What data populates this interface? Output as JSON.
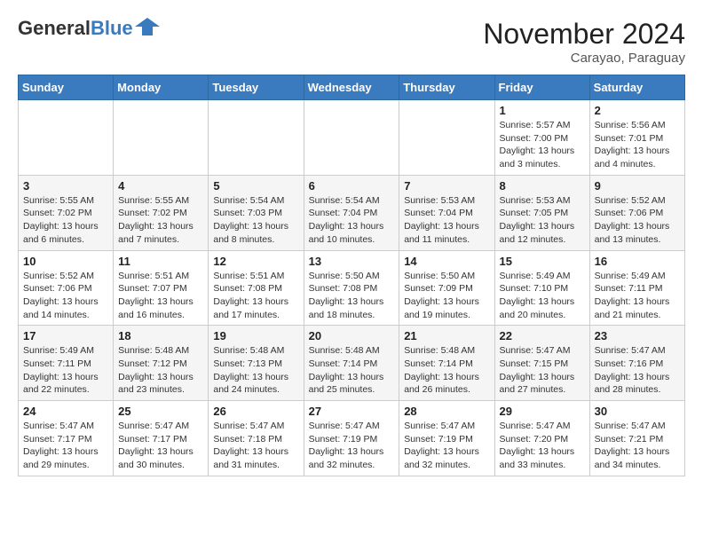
{
  "header": {
    "logo_general": "General",
    "logo_blue": "Blue",
    "month_title": "November 2024",
    "subtitle": "Carayao, Paraguay"
  },
  "weekdays": [
    "Sunday",
    "Monday",
    "Tuesday",
    "Wednesday",
    "Thursday",
    "Friday",
    "Saturday"
  ],
  "weeks": [
    [
      {
        "day": "",
        "detail": ""
      },
      {
        "day": "",
        "detail": ""
      },
      {
        "day": "",
        "detail": ""
      },
      {
        "day": "",
        "detail": ""
      },
      {
        "day": "",
        "detail": ""
      },
      {
        "day": "1",
        "detail": "Sunrise: 5:57 AM\nSunset: 7:00 PM\nDaylight: 13 hours and 3 minutes."
      },
      {
        "day": "2",
        "detail": "Sunrise: 5:56 AM\nSunset: 7:01 PM\nDaylight: 13 hours and 4 minutes."
      }
    ],
    [
      {
        "day": "3",
        "detail": "Sunrise: 5:55 AM\nSunset: 7:02 PM\nDaylight: 13 hours and 6 minutes."
      },
      {
        "day": "4",
        "detail": "Sunrise: 5:55 AM\nSunset: 7:02 PM\nDaylight: 13 hours and 7 minutes."
      },
      {
        "day": "5",
        "detail": "Sunrise: 5:54 AM\nSunset: 7:03 PM\nDaylight: 13 hours and 8 minutes."
      },
      {
        "day": "6",
        "detail": "Sunrise: 5:54 AM\nSunset: 7:04 PM\nDaylight: 13 hours and 10 minutes."
      },
      {
        "day": "7",
        "detail": "Sunrise: 5:53 AM\nSunset: 7:04 PM\nDaylight: 13 hours and 11 minutes."
      },
      {
        "day": "8",
        "detail": "Sunrise: 5:53 AM\nSunset: 7:05 PM\nDaylight: 13 hours and 12 minutes."
      },
      {
        "day": "9",
        "detail": "Sunrise: 5:52 AM\nSunset: 7:06 PM\nDaylight: 13 hours and 13 minutes."
      }
    ],
    [
      {
        "day": "10",
        "detail": "Sunrise: 5:52 AM\nSunset: 7:06 PM\nDaylight: 13 hours and 14 minutes."
      },
      {
        "day": "11",
        "detail": "Sunrise: 5:51 AM\nSunset: 7:07 PM\nDaylight: 13 hours and 16 minutes."
      },
      {
        "day": "12",
        "detail": "Sunrise: 5:51 AM\nSunset: 7:08 PM\nDaylight: 13 hours and 17 minutes."
      },
      {
        "day": "13",
        "detail": "Sunrise: 5:50 AM\nSunset: 7:08 PM\nDaylight: 13 hours and 18 minutes."
      },
      {
        "day": "14",
        "detail": "Sunrise: 5:50 AM\nSunset: 7:09 PM\nDaylight: 13 hours and 19 minutes."
      },
      {
        "day": "15",
        "detail": "Sunrise: 5:49 AM\nSunset: 7:10 PM\nDaylight: 13 hours and 20 minutes."
      },
      {
        "day": "16",
        "detail": "Sunrise: 5:49 AM\nSunset: 7:11 PM\nDaylight: 13 hours and 21 minutes."
      }
    ],
    [
      {
        "day": "17",
        "detail": "Sunrise: 5:49 AM\nSunset: 7:11 PM\nDaylight: 13 hours and 22 minutes."
      },
      {
        "day": "18",
        "detail": "Sunrise: 5:48 AM\nSunset: 7:12 PM\nDaylight: 13 hours and 23 minutes."
      },
      {
        "day": "19",
        "detail": "Sunrise: 5:48 AM\nSunset: 7:13 PM\nDaylight: 13 hours and 24 minutes."
      },
      {
        "day": "20",
        "detail": "Sunrise: 5:48 AM\nSunset: 7:14 PM\nDaylight: 13 hours and 25 minutes."
      },
      {
        "day": "21",
        "detail": "Sunrise: 5:48 AM\nSunset: 7:14 PM\nDaylight: 13 hours and 26 minutes."
      },
      {
        "day": "22",
        "detail": "Sunrise: 5:47 AM\nSunset: 7:15 PM\nDaylight: 13 hours and 27 minutes."
      },
      {
        "day": "23",
        "detail": "Sunrise: 5:47 AM\nSunset: 7:16 PM\nDaylight: 13 hours and 28 minutes."
      }
    ],
    [
      {
        "day": "24",
        "detail": "Sunrise: 5:47 AM\nSunset: 7:17 PM\nDaylight: 13 hours and 29 minutes."
      },
      {
        "day": "25",
        "detail": "Sunrise: 5:47 AM\nSunset: 7:17 PM\nDaylight: 13 hours and 30 minutes."
      },
      {
        "day": "26",
        "detail": "Sunrise: 5:47 AM\nSunset: 7:18 PM\nDaylight: 13 hours and 31 minutes."
      },
      {
        "day": "27",
        "detail": "Sunrise: 5:47 AM\nSunset: 7:19 PM\nDaylight: 13 hours and 32 minutes."
      },
      {
        "day": "28",
        "detail": "Sunrise: 5:47 AM\nSunset: 7:19 PM\nDaylight: 13 hours and 32 minutes."
      },
      {
        "day": "29",
        "detail": "Sunrise: 5:47 AM\nSunset: 7:20 PM\nDaylight: 13 hours and 33 minutes."
      },
      {
        "day": "30",
        "detail": "Sunrise: 5:47 AM\nSunset: 7:21 PM\nDaylight: 13 hours and 34 minutes."
      }
    ]
  ]
}
